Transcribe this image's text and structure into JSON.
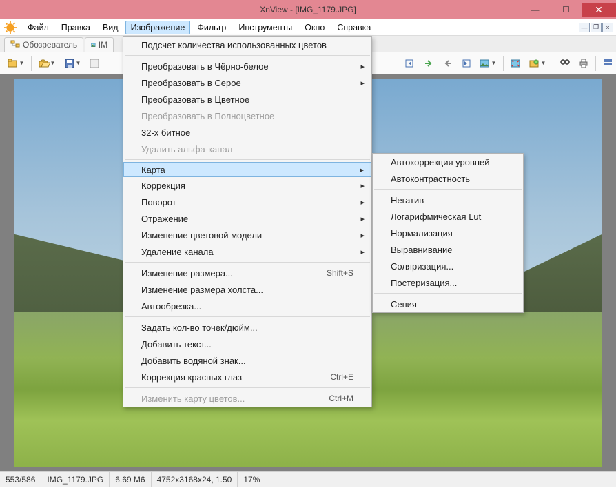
{
  "window": {
    "title": "XnView - [IMG_1179.JPG]"
  },
  "menu": {
    "items": [
      "Файл",
      "Правка",
      "Вид",
      "Изображение",
      "Фильтр",
      "Инструменты",
      "Окно",
      "Справка"
    ],
    "active_index": 3
  },
  "tabs": {
    "browser": "Обозреватель",
    "image": "IM"
  },
  "dropdown": {
    "count_colors": "Подсчет количества использованных цветов",
    "to_bw": "Преобразовать в Чёрно-белое",
    "to_gray": "Преобразовать в Серое",
    "to_color": "Преобразовать в Цветное",
    "to_truecolor": "Преобразовать в Полноцветное",
    "bit32": "32-х битное",
    "del_alpha": "Удалить альфа-канал",
    "map": "Карта",
    "correction": "Коррекция",
    "rotate": "Поворот",
    "mirror": "Отражение",
    "color_model": "Изменение цветовой модели",
    "del_channel": "Удаление канала",
    "resize": "Изменение размера...",
    "resize_kbd": "Shift+S",
    "canvas": "Изменение размера холста...",
    "autocrop": "Автообрезка...",
    "dpi": "Задать кол-во точек/дюйм...",
    "addtext": "Добавить текст...",
    "watermark": "Добавить водяной знак...",
    "redeye": "Коррекция красных глаз",
    "redeye_kbd": "Ctrl+E",
    "colormap": "Изменить карту цветов...",
    "colormap_kbd": "Ctrl+M"
  },
  "submenu": {
    "autolevels": "Автокоррекция уровней",
    "autocontrast": "Автоконтрастность",
    "negative": "Негатив",
    "loglut": "Логарифмическая Lut",
    "normalize": "Нормализация",
    "equalize": "Выравнивание",
    "solarize": "Соляризация...",
    "posterize": "Постеризация...",
    "sepia": "Сепия"
  },
  "status": {
    "pos": "553/586",
    "file": "IMG_1179.JPG",
    "size": "6.69 M6",
    "dims": "4752x3168x24, 1.50",
    "zoom": "17%"
  },
  "icons": {
    "browser_tab": "tree",
    "image_tab": "picture"
  },
  "colors": {
    "accent": "#cde8ff",
    "titlebar": "#e38792"
  }
}
